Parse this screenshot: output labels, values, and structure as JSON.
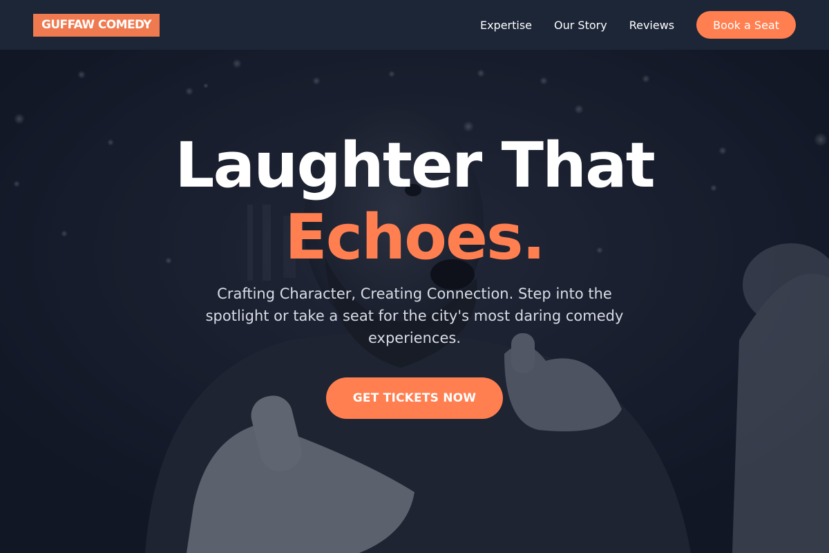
{
  "brand": {
    "logo_text": "GUFFAW COMEDY",
    "accent_color": "#ff7f50"
  },
  "nav": {
    "links": [
      {
        "label": "Expertise"
      },
      {
        "label": "Our Story"
      },
      {
        "label": "Reviews"
      }
    ],
    "cta_label": "Book a Seat"
  },
  "hero": {
    "headline_line1": "Laughter That",
    "headline_line2": "Echoes.",
    "subtitle": "Crafting Character, Creating Connection. Step into the spotlight or take a seat for the city's most daring comedy experiences.",
    "cta_label": "GET TICKETS NOW",
    "background_description": "comedian-pointing-photo"
  }
}
